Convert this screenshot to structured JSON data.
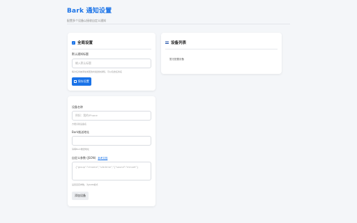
{
  "header": {
    "title": "Bark 通知设置",
    "subtitle": "配置多个设备以接收自定义通知"
  },
  "global_settings": {
    "title": "全局设置",
    "default_title_label": "默认通知标题",
    "default_title_placeholder": "输入默认标题",
    "default_title_hint": "每次任务被添加或更改时发送的通知，可以包含任务名",
    "save_button": "保存设置"
  },
  "device_list": {
    "title": "设备列表",
    "empty_text": "暂无配置设备"
  },
  "add_device": {
    "name_label": "设备名称",
    "name_placeholder": "例如：我的iPhone",
    "name_hint": "方便识别设备名",
    "url_label": "Bark推送地址",
    "url_placeholder": "",
    "url_hint": "请填Bark推送地址",
    "params_label": "自定义参数 (JSON)",
    "params_link": "参考文档",
    "params_placeholder": "{\"group\":\"chrome\",\"sile:time\",\"{\"sound\":\"minuet\"}",
    "params_hint": "设置自定参数，为JSON格式",
    "add_button": "添加设备"
  },
  "colors": {
    "accent": "#1a73e8",
    "background": "#f4f6f9"
  }
}
